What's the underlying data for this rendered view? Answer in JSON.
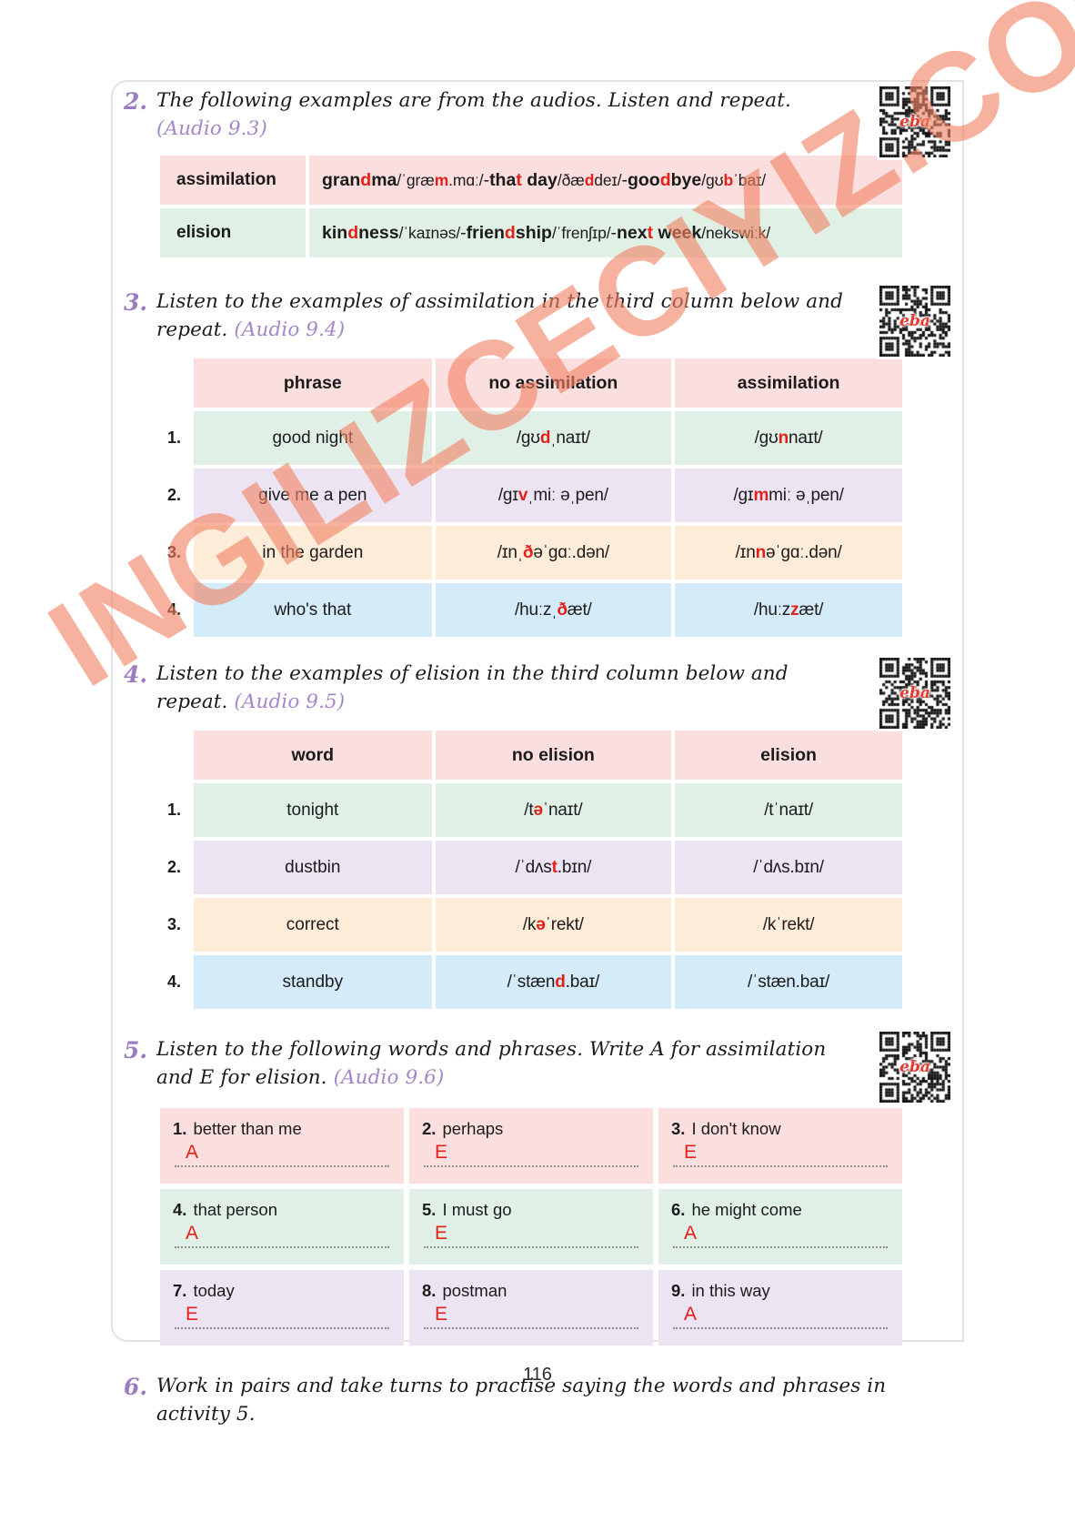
{
  "page": {
    "number": "116",
    "watermark": "INGILIZCECIYIZ.COM"
  },
  "qr": {
    "label": "eba"
  },
  "activity2": {
    "number": "2.",
    "instruction": "The following examples are from the audios. Listen and repeat.",
    "audio": "(Audio 9.3)",
    "rows": [
      {
        "label": "assimilation",
        "items": [
          {
            "word_pre": "gran",
            "word_hl": "d",
            "word_post": "ma",
            "ipa_pre": "/ˈɡræ",
            "ipa_hl": "m",
            "ipa_post": ".mɑː/"
          },
          {
            "word_pre": "tha",
            "word_hl": "t",
            "word_post": " day",
            "ipa_pre": "/ðæ",
            "ipa_hl": "d",
            "ipa_post": "deɪ/"
          },
          {
            "word_pre": "goo",
            "word_hl": "d",
            "word_post": "bye",
            "ipa_pre": "/ɡʊ",
            "ipa_hl": "b",
            "ipa_post": "ˈbaɪ/"
          }
        ]
      },
      {
        "label": "elision",
        "items": [
          {
            "word_pre": "kin",
            "word_hl": "d",
            "word_post": "ness",
            "ipa_pre": "/ˈkaɪnəs/",
            "ipa_hl": "",
            "ipa_post": ""
          },
          {
            "word_pre": "frien",
            "word_hl": "d",
            "word_post": "ship",
            "ipa_pre": "/ˈfrenʃɪp/",
            "ipa_hl": "",
            "ipa_post": ""
          },
          {
            "word_pre": "nex",
            "word_hl": "t",
            "word_post": " week",
            "ipa_pre": "/nekswiːk/",
            "ipa_hl": "",
            "ipa_post": ""
          }
        ]
      }
    ],
    "separator": "-"
  },
  "activity3": {
    "number": "3.",
    "instruction": "Listen to the examples of assimilation in the third column below and repeat.",
    "audio": "(Audio 9.4)",
    "headers": [
      "phrase",
      "no assimilation",
      "assimilation"
    ],
    "rows": [
      {
        "idx": "1.",
        "phrase": "good night",
        "no_pre": "/ɡʊ",
        "no_hl": "d",
        "no_post": "ˌnaɪt/",
        "yes_pre": "/ɡʊ",
        "yes_hl": "n",
        "yes_post": "naɪt/"
      },
      {
        "idx": "2.",
        "phrase": "give me a pen",
        "no_pre": "/ɡɪ",
        "no_hl": "v",
        "no_post": "ˌmiː əˌpen/",
        "yes_pre": "/ɡɪ",
        "yes_hl": "m",
        "yes_post": "miː əˌpen/"
      },
      {
        "idx": "3.",
        "phrase": "in the garden",
        "no_pre": "/ɪnˌ",
        "no_hl": "ð",
        "no_post": "əˈɡɑː.dən/",
        "yes_pre": "/ɪn",
        "yes_hl": "n",
        "yes_post": "əˈɡɑː.dən/"
      },
      {
        "idx": "4.",
        "phrase": "who's that",
        "no_pre": "/huːzˌ",
        "no_hl": "ð",
        "no_post": "æt/",
        "yes_pre": "/huːz",
        "yes_hl": "z",
        "yes_post": "æt/"
      }
    ]
  },
  "activity4": {
    "number": "4.",
    "instruction": "Listen to the examples of elision in the third column below and repeat.",
    "audio": "(Audio 9.5)",
    "headers": [
      "word",
      "no elision",
      "elision"
    ],
    "rows": [
      {
        "idx": "1.",
        "word": "tonight",
        "no_pre": "/t",
        "no_hl": "ə",
        "no_post": "ˈnaɪt/",
        "yes_pre": "/tˈnaɪt/",
        "yes_hl": "",
        "yes_post": ""
      },
      {
        "idx": "2.",
        "word": "dustbin",
        "no_pre": "/ˈdʌs",
        "no_hl": "t",
        "no_post": ".bɪn/",
        "yes_pre": "/ˈdʌs.bɪn/",
        "yes_hl": "",
        "yes_post": ""
      },
      {
        "idx": "3.",
        "word": "correct",
        "no_pre": "/k",
        "no_hl": "ə",
        "no_post": "ˈrekt/",
        "yes_pre": "/kˈrekt/",
        "yes_hl": "",
        "yes_post": ""
      },
      {
        "idx": "4.",
        "word": "standby",
        "no_pre": "/ˈstæn",
        "no_hl": "d",
        "no_post": ".baɪ/",
        "yes_pre": "/ˈstæn.baɪ/",
        "yes_hl": "",
        "yes_post": ""
      }
    ]
  },
  "activity5": {
    "number": "5.",
    "instruction": "Listen to the following words and phrases. Write A for assimilation and E for elision.",
    "audio": "(Audio 9.6)",
    "items": [
      {
        "num": "1.",
        "text": "better than me",
        "answer": "A"
      },
      {
        "num": "2.",
        "text": "perhaps",
        "answer": "E"
      },
      {
        "num": "3.",
        "text": "I don't know",
        "answer": "E"
      },
      {
        "num": "4.",
        "text": "that person",
        "answer": "A"
      },
      {
        "num": "5.",
        "text": "I must go",
        "answer": "E"
      },
      {
        "num": "6.",
        "text": "he might come",
        "answer": "A"
      },
      {
        "num": "7.",
        "text": "today",
        "answer": "E"
      },
      {
        "num": "8.",
        "text": "postman",
        "answer": "E"
      },
      {
        "num": "9.",
        "text": "in this way",
        "answer": "A"
      }
    ]
  },
  "activity6": {
    "number": "6.",
    "instruction": "Work in pairs and take turns to practise saying the words and phrases in activity 5."
  }
}
